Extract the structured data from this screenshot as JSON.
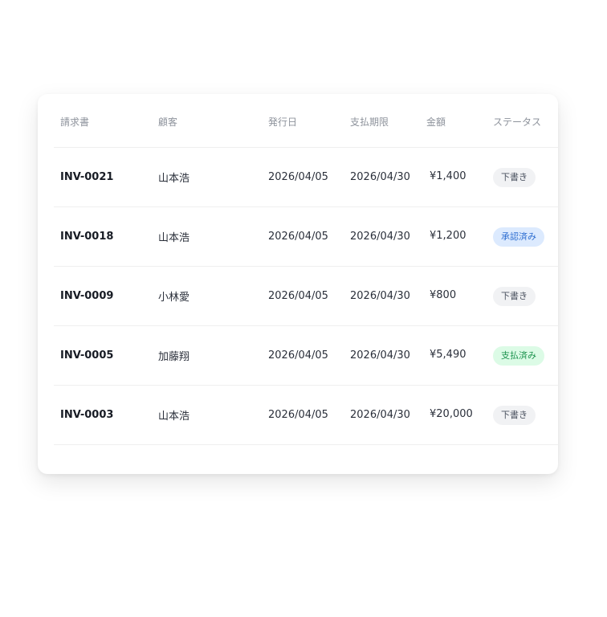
{
  "table": {
    "headers": {
      "invoice": "請求書",
      "customer": "顧客",
      "issue_date": "発行日",
      "due_date": "支払期限",
      "amount": "金額",
      "status": "ステータス"
    },
    "rows": [
      {
        "invoice": "INV-0021",
        "customer": "山本浩",
        "issue_date": "2026/04/05",
        "due_date": "2026/04/30",
        "amount": "¥1,400",
        "status": "下書き",
        "status_kind": "draft"
      },
      {
        "invoice": "INV-0018",
        "customer": "山本浩",
        "issue_date": "2026/04/05",
        "due_date": "2026/04/30",
        "amount": "¥1,200",
        "status": "承認済み",
        "status_kind": "approved"
      },
      {
        "invoice": "INV-0009",
        "customer": "小林愛",
        "issue_date": "2026/04/05",
        "due_date": "2026/04/30",
        "amount": "¥800",
        "status": "下書き",
        "status_kind": "draft"
      },
      {
        "invoice": "INV-0005",
        "customer": "加藤翔",
        "issue_date": "2026/04/05",
        "due_date": "2026/04/30",
        "amount": "¥5,490",
        "status": "支払済み",
        "status_kind": "paid"
      },
      {
        "invoice": "INV-0003",
        "customer": "山本浩",
        "issue_date": "2026/04/05",
        "due_date": "2026/04/30",
        "amount": "¥20,000",
        "status": "下書き",
        "status_kind": "draft"
      }
    ]
  },
  "colors": {
    "draft_badge_bg": "#f1f2f4",
    "approved_badge_bg": "#dceafe",
    "paid_badge_bg": "#dcfbe6"
  }
}
